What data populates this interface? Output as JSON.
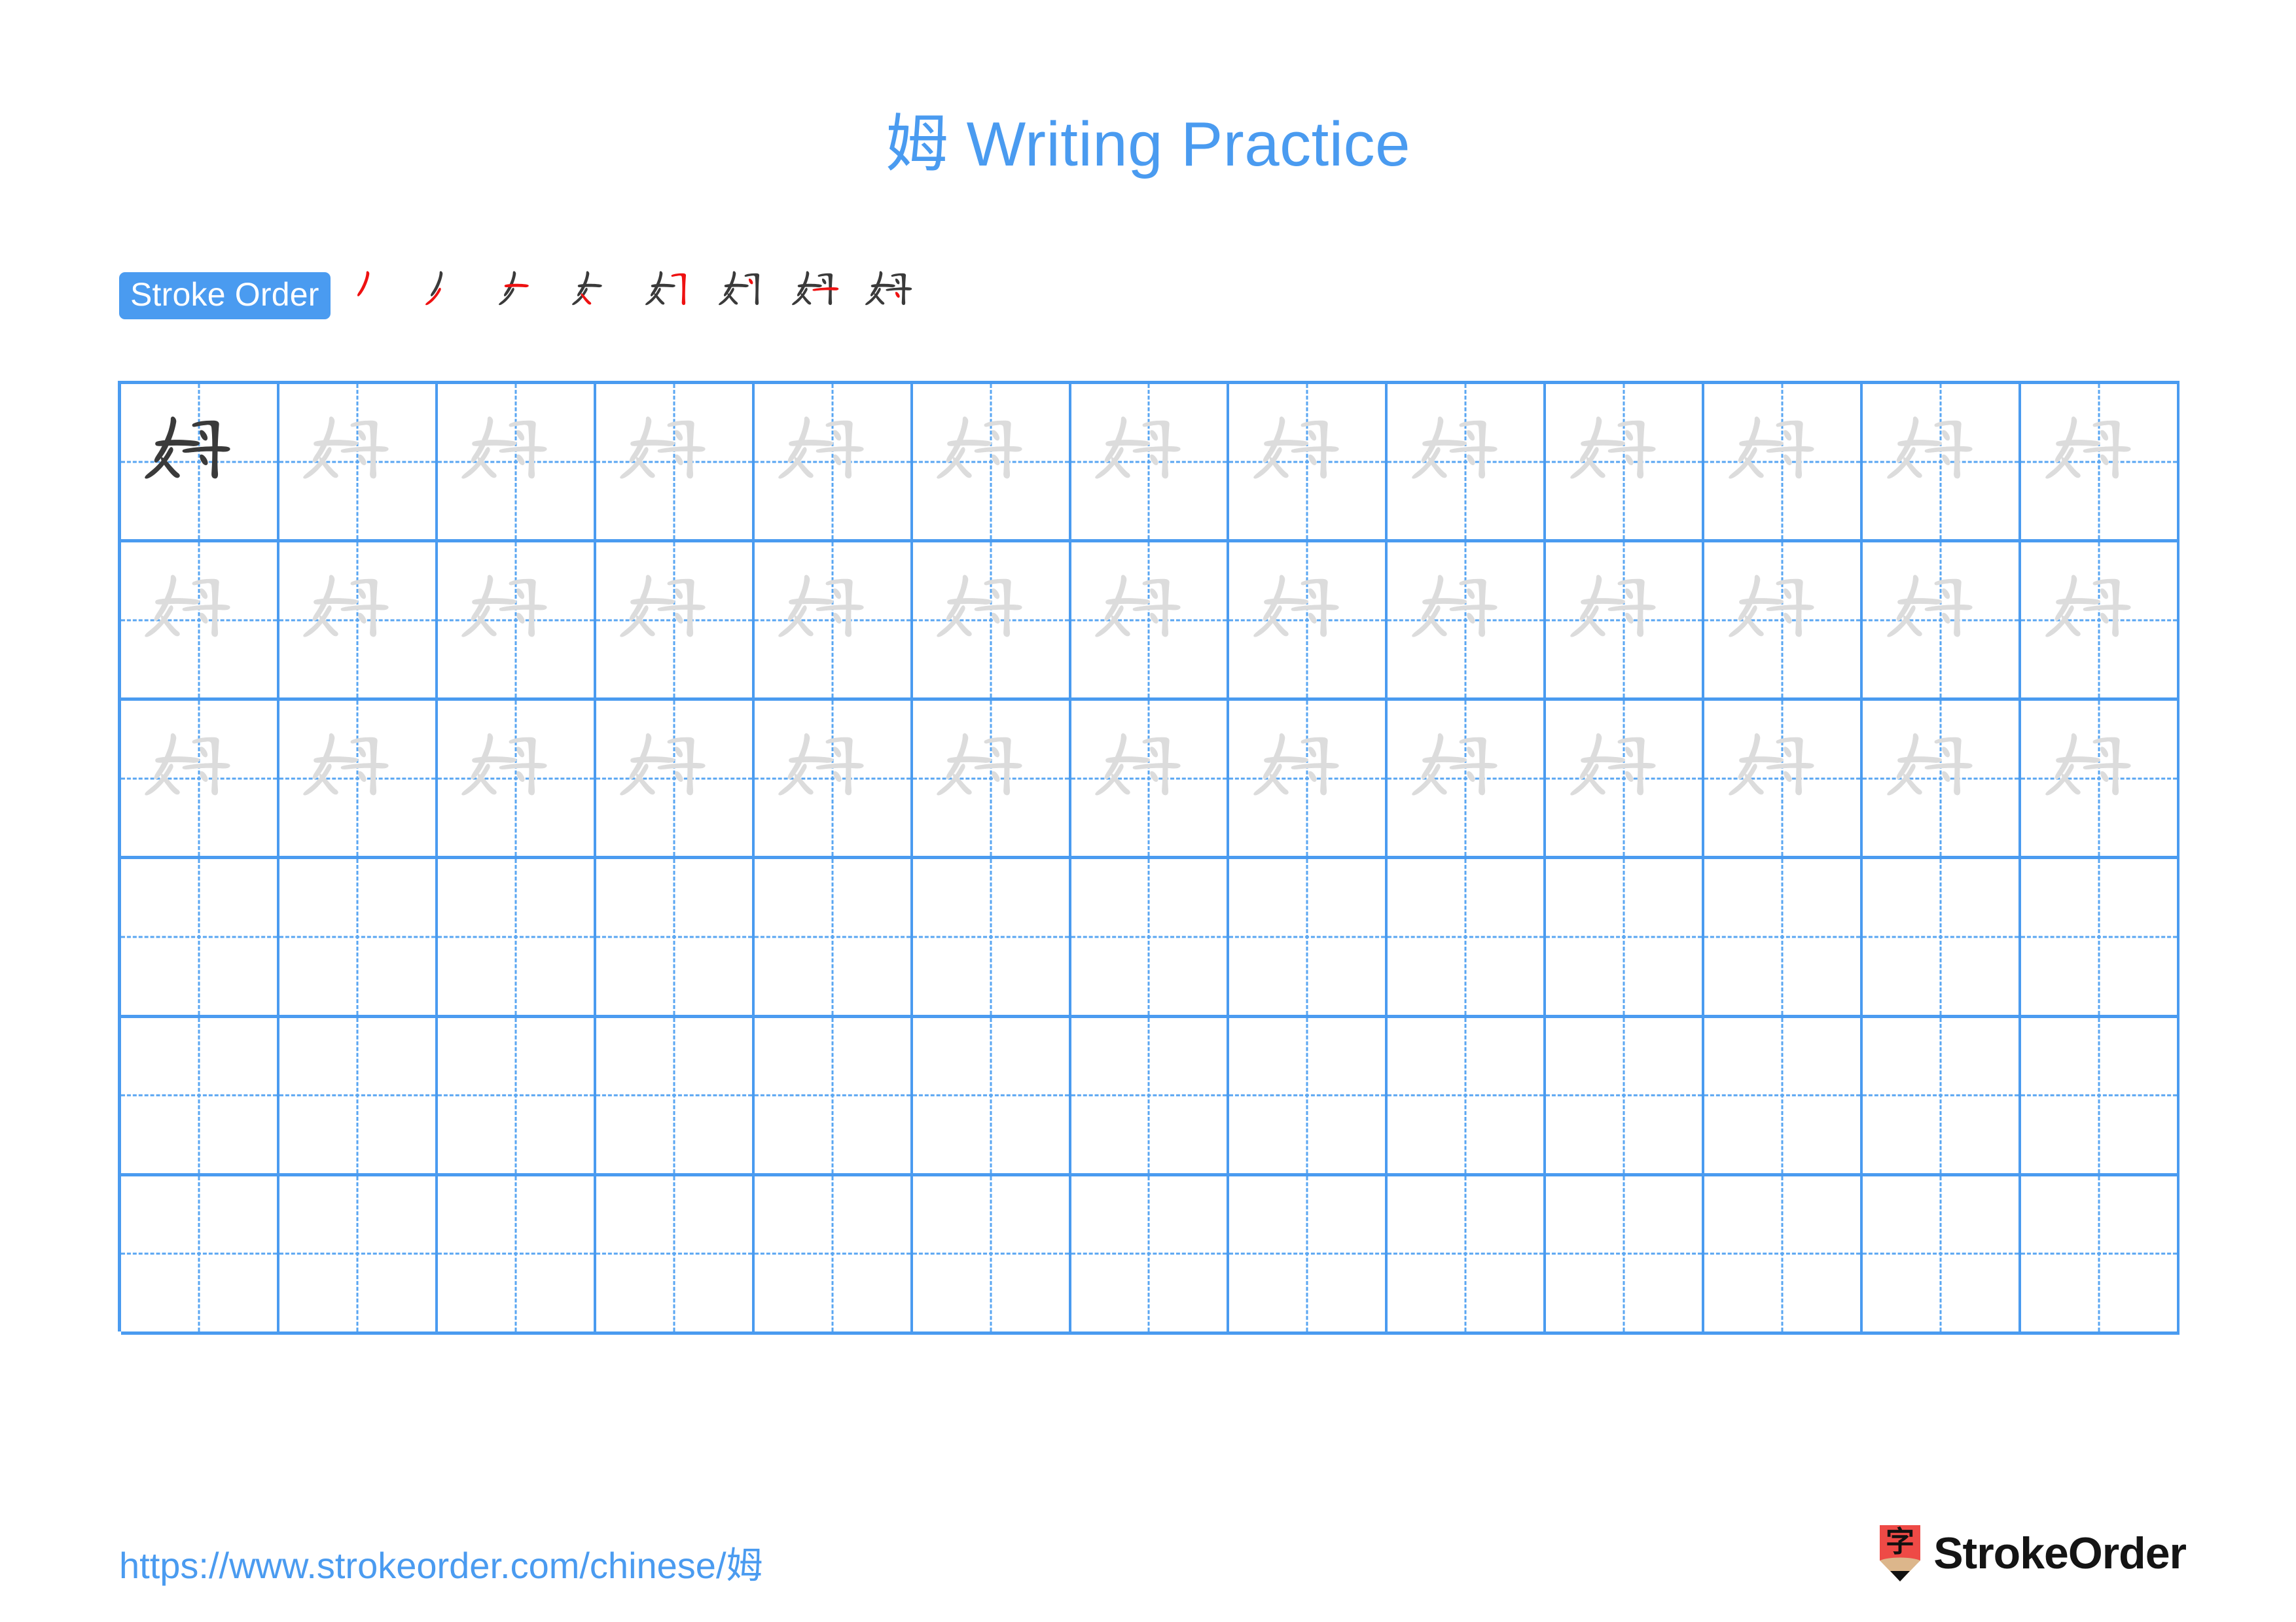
{
  "character": "姆",
  "title": "姆 Writing Practice",
  "colors": {
    "accent_blue": "#4a9bf0",
    "grid_line": "#4a9bf0",
    "grid_dash": "#59a6f2",
    "trace_gray": "#dcdcdc",
    "model_dark": "#3a3a3a",
    "active_stroke_red": "#ee1111",
    "logo_red": "#ee4a46",
    "logo_wood": "#dcb68b",
    "logo_tip": "#111111",
    "brand_text": "#141414"
  },
  "stroke_order": {
    "label": "Stroke Order",
    "total_strokes": 8,
    "steps": [
      {
        "index": 1,
        "strokes_shown": 1,
        "new_stroke": "撇点 (piě-diǎn)"
      },
      {
        "index": 2,
        "strokes_shown": 2,
        "new_stroke": "撇 (piě)"
      },
      {
        "index": 3,
        "strokes_shown": 3,
        "new_stroke": "横 (héng)"
      },
      {
        "index": 4,
        "strokes_shown": 4,
        "new_stroke": "竖折 (shù-zhé)"
      },
      {
        "index": 5,
        "strokes_shown": 5,
        "new_stroke": "横折钩 (héng-zhé-gōu)"
      },
      {
        "index": 6,
        "strokes_shown": 6,
        "new_stroke": "点 (diǎn)"
      },
      {
        "index": 7,
        "strokes_shown": 7,
        "new_stroke": "横 (héng)"
      },
      {
        "index": 8,
        "strokes_shown": 8,
        "new_stroke": "点 (diǎn)"
      }
    ]
  },
  "grid": {
    "columns": 13,
    "rows": 6,
    "rows_data": [
      {
        "row": 1,
        "cells": [
          "model",
          "trace",
          "trace",
          "trace",
          "trace",
          "trace",
          "trace",
          "trace",
          "trace",
          "trace",
          "trace",
          "trace",
          "trace"
        ]
      },
      {
        "row": 2,
        "cells": [
          "trace",
          "trace",
          "trace",
          "trace",
          "trace",
          "trace",
          "trace",
          "trace",
          "trace",
          "trace",
          "trace",
          "trace",
          "trace"
        ]
      },
      {
        "row": 3,
        "cells": [
          "trace",
          "trace",
          "trace",
          "trace",
          "trace",
          "trace",
          "trace",
          "trace",
          "trace",
          "trace",
          "trace",
          "trace",
          "trace"
        ]
      },
      {
        "row": 4,
        "cells": [
          "empty",
          "empty",
          "empty",
          "empty",
          "empty",
          "empty",
          "empty",
          "empty",
          "empty",
          "empty",
          "empty",
          "empty",
          "empty"
        ]
      },
      {
        "row": 5,
        "cells": [
          "empty",
          "empty",
          "empty",
          "empty",
          "empty",
          "empty",
          "empty",
          "empty",
          "empty",
          "empty",
          "empty",
          "empty",
          "empty"
        ]
      },
      {
        "row": 6,
        "cells": [
          "empty",
          "empty",
          "empty",
          "empty",
          "empty",
          "empty",
          "empty",
          "empty",
          "empty",
          "empty",
          "empty",
          "empty",
          "empty"
        ]
      }
    ]
  },
  "footer": {
    "url": "https://www.strokeorder.com/chinese/姆",
    "brand_name": "StrokeOrder",
    "logo_char": "字"
  }
}
